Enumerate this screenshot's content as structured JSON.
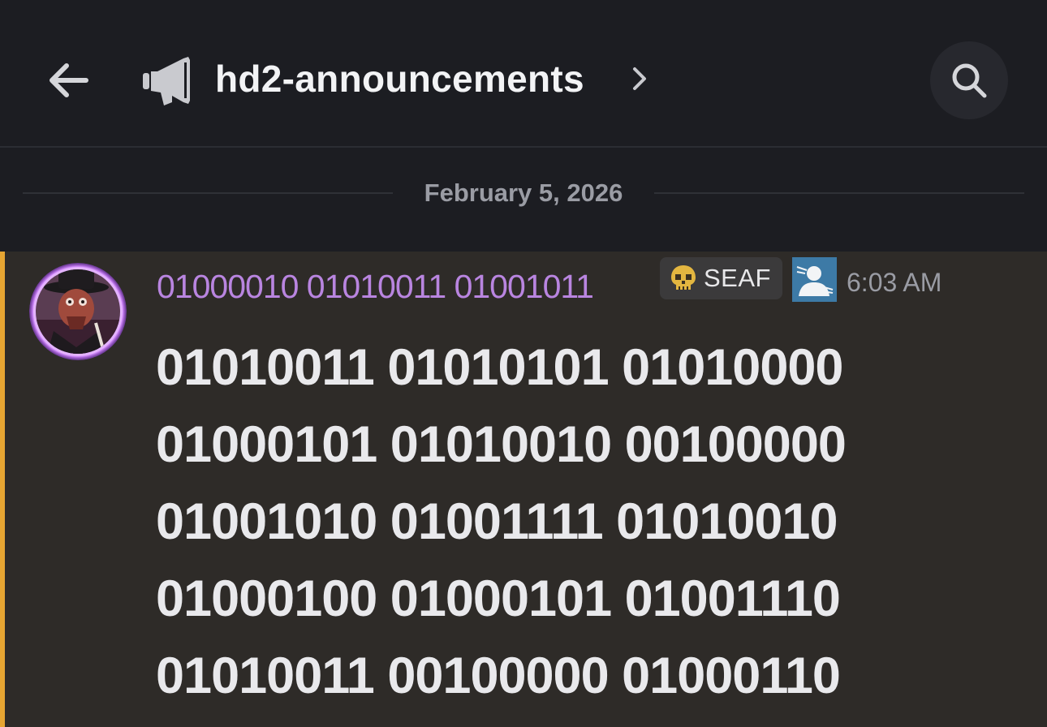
{
  "header": {
    "back_icon": "arrow-left-icon",
    "channel_icon": "megaphone-icon",
    "channel_name": "hd2-announcements",
    "channel_chevron_icon": "chevron-right-icon",
    "search_icon": "search-icon"
  },
  "divider": {
    "date": "February 5, 2026"
  },
  "message": {
    "author": "01000010 01010011 01001011",
    "author_color": "#b985e0",
    "tag": {
      "icon": "skull-icon",
      "label": "SEAF"
    },
    "role_icon": "role-badge-icon",
    "timestamp": "6:03 AM",
    "highlight_color": "#e6a532",
    "content_lines": [
      "01010011 01010101 01010000",
      "01000101 01010010 00100000",
      "01001010 01001111 01010010",
      "01000100 01000101 01001110",
      "01010011 00100000 01000110"
    ]
  }
}
